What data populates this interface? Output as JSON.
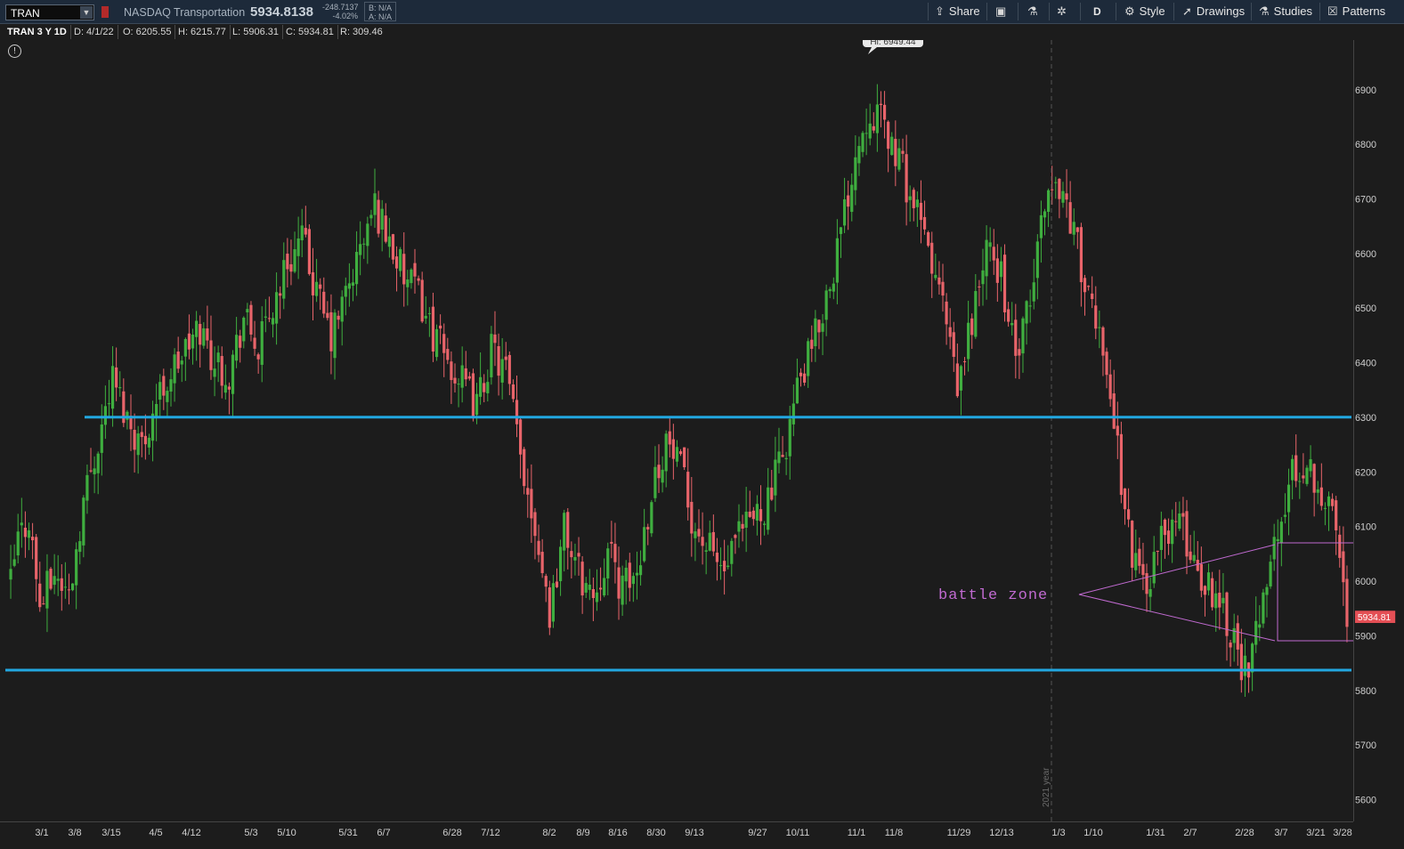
{
  "toolbar": {
    "symbol": "TRAN",
    "symbol_name": "NASDAQ Transportation",
    "last_price": "5934.8138",
    "change_abs": "-248.7137",
    "change_pct": "-4.02%",
    "bid": "B: N/A",
    "ask": "A: N/A",
    "share_label": "Share",
    "aggregation": "D",
    "style_label": "Style",
    "drawings_label": "Drawings",
    "studies_label": "Studies",
    "patterns_label": "Patterns"
  },
  "infobar": {
    "symbol_period": "TRAN 3 Y 1D",
    "date": "D: 4/1/22",
    "open": "O: 6205.55",
    "high": "H: 6215.77",
    "low": "L: 5906.31",
    "close": "C: 5934.81",
    "range": "R: 309.46"
  },
  "chart": {
    "hi_bubble": "Hi: 6949.44",
    "last_price_label": "5934.81",
    "annotation_text": "battle zone",
    "year_marker": "2021 year",
    "support_level": 5845,
    "resistance_level": 6300,
    "colors": {
      "up": "#3fae3f",
      "down": "#e8646a",
      "level": "#22a7e0",
      "annotation": "#c06ad0",
      "last_price": "#e44f55"
    }
  },
  "chart_data": {
    "type": "candlestick",
    "ylim": [
      5580,
      7000
    ],
    "y_ticks": [
      5600,
      5700,
      5800,
      5900,
      6000,
      6100,
      6200,
      6300,
      6400,
      6500,
      6600,
      6700,
      6800,
      6900
    ],
    "x_ticks": [
      "3/1",
      "3/8",
      "3/15",
      "4/5",
      "4/12",
      "5/3",
      "5/10",
      "5/31",
      "6/7",
      "6/28",
      "7/12",
      "8/2",
      "8/9",
      "8/16",
      "8/30",
      "9/13",
      "9/27",
      "10/11",
      "11/1",
      "11/8",
      "11/29",
      "12/13",
      "1/3",
      "1/10",
      "1/31",
      "2/7",
      "2/28",
      "3/7",
      "3/21",
      "3/28"
    ],
    "anchors": [
      [
        0,
        6000
      ],
      [
        2,
        6080
      ],
      [
        5,
        6120
      ],
      [
        8,
        5960
      ],
      [
        12,
        6020
      ],
      [
        16,
        5980
      ],
      [
        20,
        6150
      ],
      [
        24,
        6260
      ],
      [
        28,
        6370
      ],
      [
        32,
        6300
      ],
      [
        36,
        6250
      ],
      [
        40,
        6330
      ],
      [
        44,
        6380
      ],
      [
        48,
        6420
      ],
      [
        52,
        6460
      ],
      [
        56,
        6400
      ],
      [
        60,
        6380
      ],
      [
        64,
        6480
      ],
      [
        68,
        6420
      ],
      [
        72,
        6500
      ],
      [
        76,
        6580
      ],
      [
        80,
        6620
      ],
      [
        84,
        6520
      ],
      [
        88,
        6440
      ],
      [
        92,
        6520
      ],
      [
        96,
        6600
      ],
      [
        100,
        6680
      ],
      [
        104,
        6620
      ],
      [
        108,
        6550
      ],
      [
        112,
        6520
      ],
      [
        116,
        6450
      ],
      [
        120,
        6400
      ],
      [
        124,
        6360
      ],
      [
        128,
        6320
      ],
      [
        132,
        6420
      ],
      [
        136,
        6380
      ],
      [
        140,
        6230
      ],
      [
        144,
        6110
      ],
      [
        148,
        5950
      ],
      [
        152,
        6100
      ],
      [
        156,
        6020
      ],
      [
        160,
        5980
      ],
      [
        164,
        6060
      ],
      [
        168,
        5990
      ],
      [
        172,
        6020
      ],
      [
        176,
        6170
      ],
      [
        180,
        6260
      ],
      [
        184,
        6200
      ],
      [
        188,
        6100
      ],
      [
        192,
        6060
      ],
      [
        196,
        6020
      ],
      [
        200,
        6080
      ],
      [
        204,
        6120
      ],
      [
        208,
        6150
      ],
      [
        212,
        6230
      ],
      [
        216,
        6350
      ],
      [
        220,
        6420
      ],
      [
        224,
        6520
      ],
      [
        228,
        6630
      ],
      [
        232,
        6780
      ],
      [
        236,
        6860
      ],
      [
        240,
        6820
      ],
      [
        244,
        6760
      ],
      [
        248,
        6680
      ],
      [
        252,
        6600
      ],
      [
        256,
        6500
      ],
      [
        260,
        6340
      ],
      [
        264,
        6480
      ],
      [
        268,
        6600
      ],
      [
        272,
        6560
      ],
      [
        276,
        6400
      ],
      [
        280,
        6500
      ],
      [
        284,
        6700
      ],
      [
        288,
        6720
      ],
      [
        292,
        6640
      ],
      [
        296,
        6500
      ],
      [
        300,
        6440
      ],
      [
        304,
        6240
      ],
      [
        308,
        6050
      ],
      [
        312,
        6000
      ],
      [
        316,
        6080
      ],
      [
        320,
        6120
      ],
      [
        324,
        6060
      ],
      [
        328,
        6000
      ],
      [
        332,
        5980
      ],
      [
        336,
        5900
      ],
      [
        340,
        5820
      ],
      [
        344,
        6000
      ],
      [
        348,
        6080
      ],
      [
        352,
        6200
      ],
      [
        356,
        6220
      ],
      [
        360,
        6170
      ],
      [
        364,
        6100
      ],
      [
        367,
        5940
      ]
    ],
    "n_bars": 368
  }
}
